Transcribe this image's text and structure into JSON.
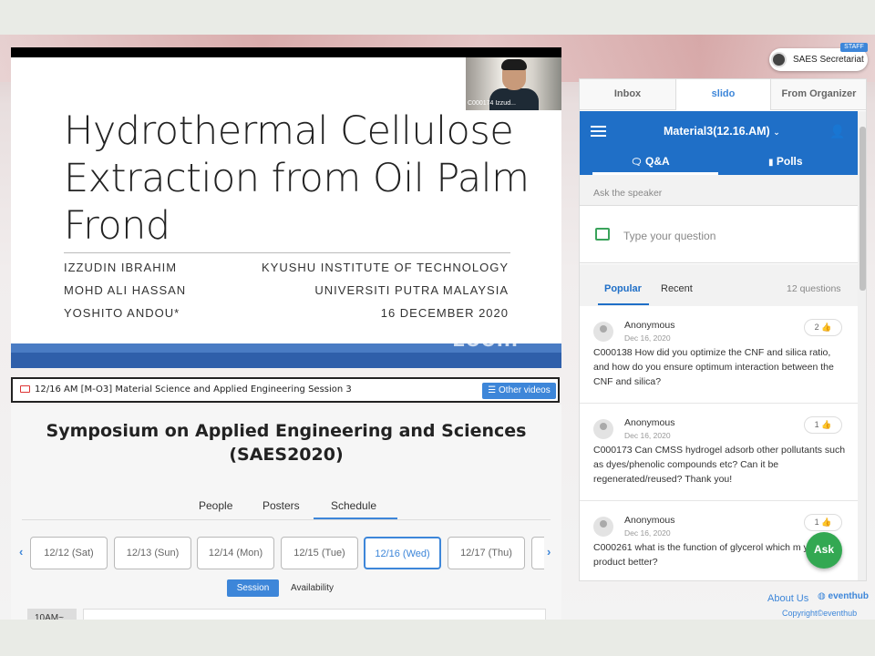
{
  "slide": {
    "title_lines": [
      "Hydrothermal Cellulose",
      "Extraction from Oil Palm",
      "Frond"
    ],
    "authors": [
      "IZZUDIN IBRAHIM",
      "MOHD ALI HASSAN",
      "YOSHITO ANDOU*"
    ],
    "affiliations": [
      "KYUSHU INSTITUTE OF TECHNOLOGY",
      "UNIVERSITI PUTRA MALAYSIA",
      "16 DECEMBER 2020"
    ],
    "watermark": "zoom",
    "camera_label": "C000174 Izzud..."
  },
  "session_bar": {
    "text": "12/16 AM [M-O3] Material Science and Applied Engineering Session 3",
    "other_videos": "Other videos"
  },
  "main": {
    "title_line1": "Symposium on Applied Engineering and Sciences",
    "title_line2": "(SAES2020)",
    "tabs": [
      "People",
      "Posters",
      "Schedule"
    ],
    "dates": [
      "12/12 (Sat)",
      "12/13 (Sun)",
      "12/14 (Mon)",
      "12/15 (Tue)",
      "12/16 (Wed)",
      "12/17 (Thu)"
    ],
    "view_tabs": [
      "Session",
      "Availability"
    ],
    "time_label": "10AM~"
  },
  "staff": {
    "badge": "STAFF",
    "name": "SAES Secretariat"
  },
  "right_panel": {
    "tabs": [
      "Inbox",
      "slido",
      "From Organizer"
    ],
    "event_name": "Material3(12.16.AM)",
    "slido_tabs": [
      "Q&A",
      "Polls"
    ],
    "ask_label": "Ask the speaker",
    "input_placeholder": "Type your question",
    "filters": [
      "Popular",
      "Recent"
    ],
    "question_count": "12 questions",
    "questions": [
      {
        "author": "Anonymous",
        "date": "Dec 16, 2020",
        "likes": "2",
        "text": "C000138 How did you optimize the CNF and silica ratio, and how do you ensure optimum interaction between the CNF and silica?"
      },
      {
        "author": "Anonymous",
        "date": "Dec 16, 2020",
        "likes": "1",
        "text": "C000173 Can CMSS hydrogel adsorb other pollutants such as dyes/phenolic compounds etc? Can it be regenerated/reused? Thank you!"
      },
      {
        "author": "Anonymous",
        "date": "Dec 16, 2020",
        "likes": "1",
        "text": "C000261 what is the function of glycerol which m your product better?"
      }
    ],
    "ask_button": "Ask"
  },
  "footer": {
    "about": "About Us",
    "brand": "eventhub",
    "copyright": "Copyright©eventhub"
  }
}
